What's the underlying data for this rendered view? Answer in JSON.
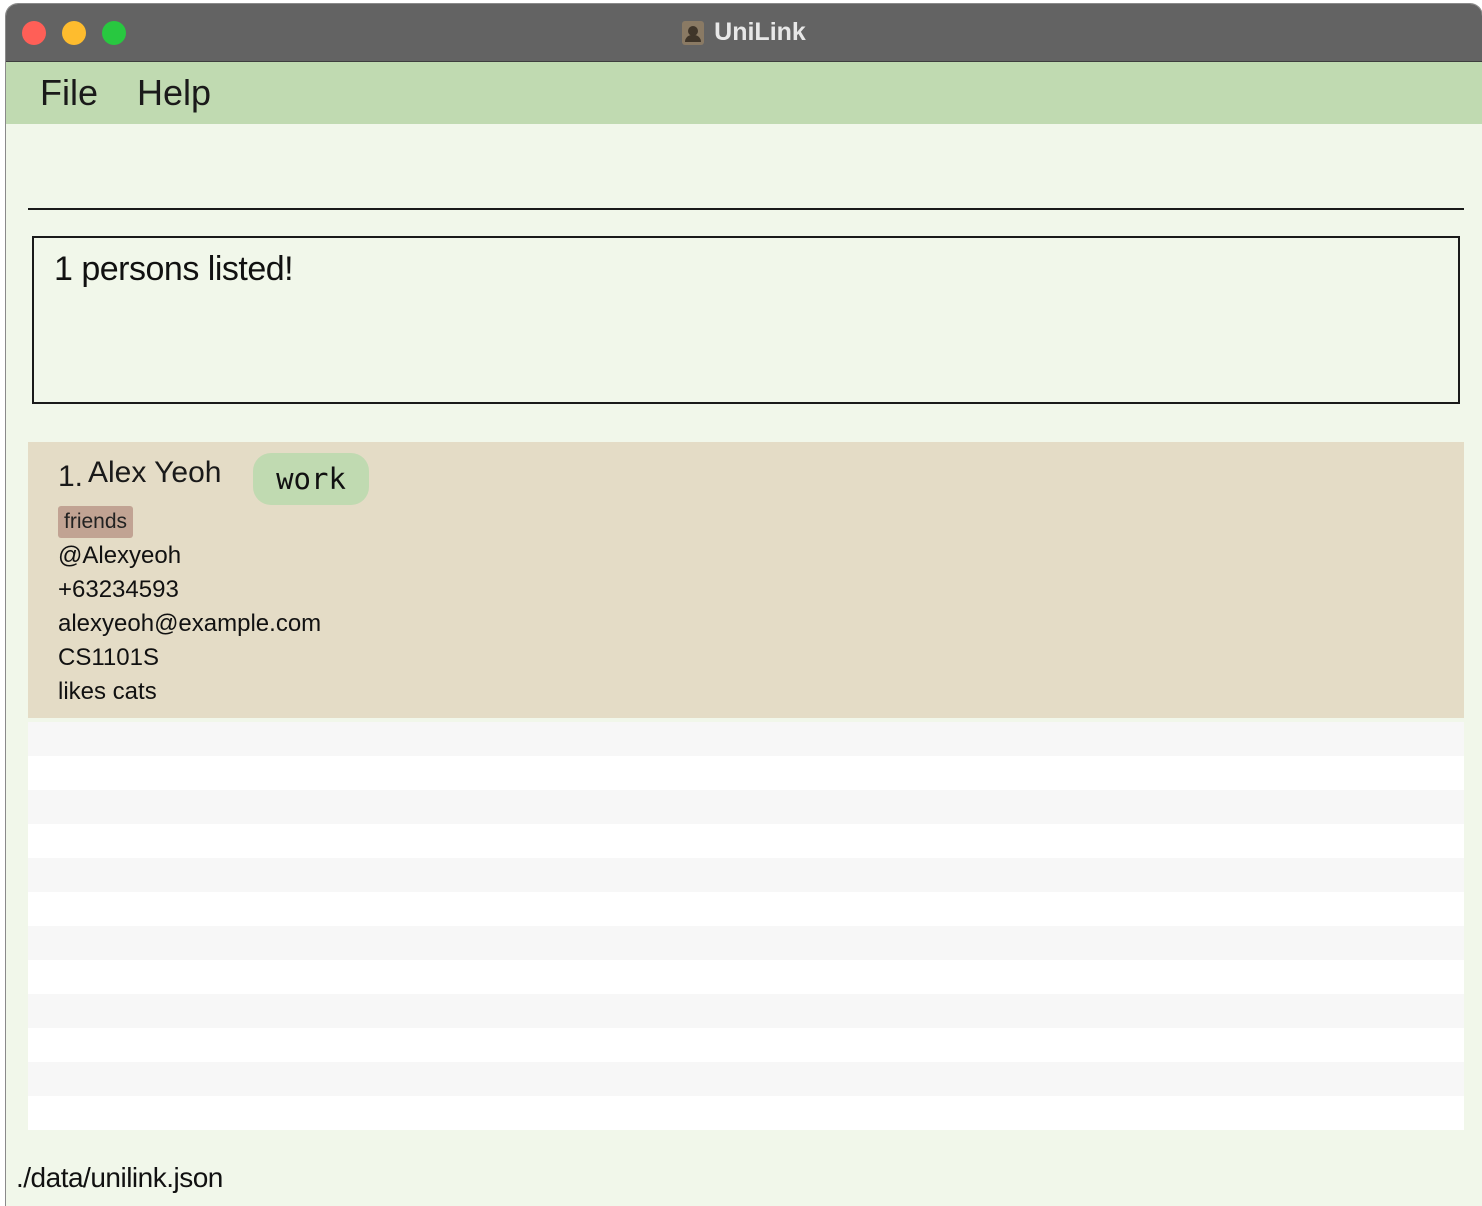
{
  "window": {
    "title": "UniLink"
  },
  "menu": {
    "file": "File",
    "help": "Help"
  },
  "command": {
    "value": ""
  },
  "result": {
    "message": "1 persons listed!"
  },
  "persons": [
    {
      "index": "1.",
      "name": "Alex Yeoh",
      "role_tag": "work",
      "tags": [
        "friends"
      ],
      "handle": "@Alexyeoh",
      "phone": "+63234593",
      "email": "alexyeoh@example.com",
      "module": "CS1101S",
      "remark": "likes cats"
    }
  ],
  "status": {
    "file_path": "./data/unilink.json"
  },
  "colors": {
    "menubar": "#c0dab1",
    "background": "#f1f7ea",
    "card": "#e4dcc6",
    "friends_tag": "#c1a393",
    "work_tag": "#c0dab1"
  }
}
